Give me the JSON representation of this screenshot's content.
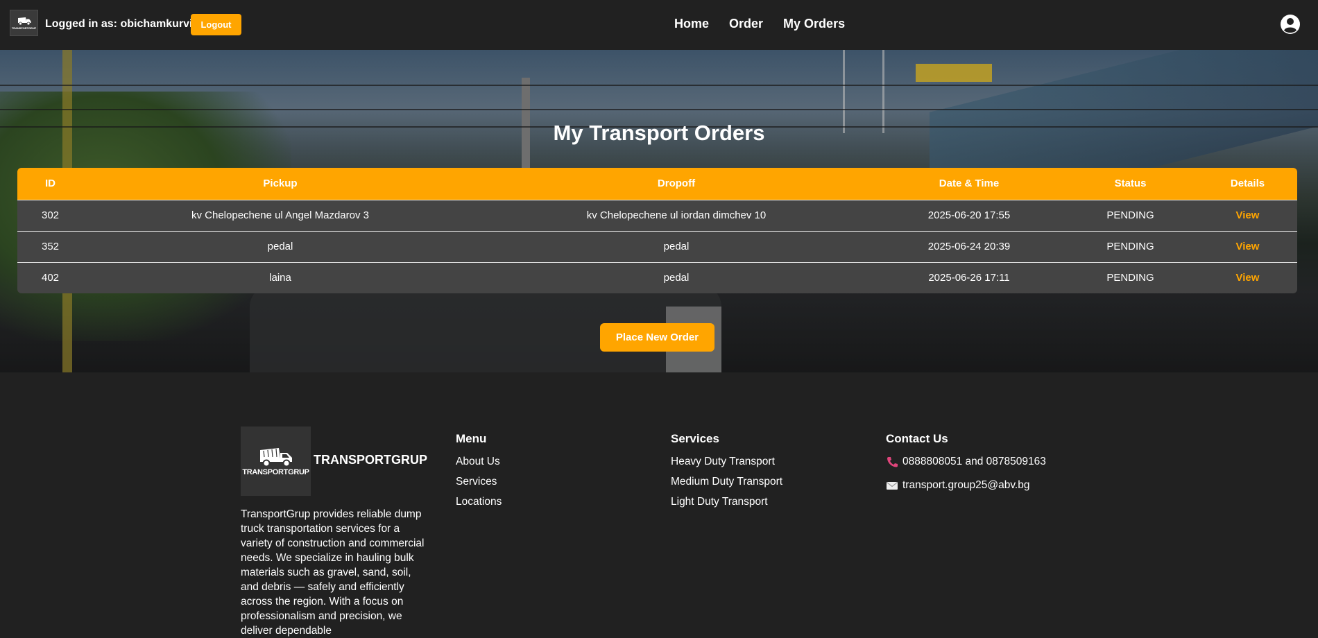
{
  "header": {
    "logo_text": "TRANSPORTGRUP",
    "logged_in_text": "Logged in as: obichamkurvi",
    "logout_label": "Logout",
    "nav": [
      {
        "label": "Home"
      },
      {
        "label": "Order"
      },
      {
        "label": "My Orders"
      }
    ],
    "user_icon": "user-circle-icon"
  },
  "main": {
    "title": "My Transport Orders",
    "columns": [
      "ID",
      "Pickup",
      "Dropoff",
      "Date & Time",
      "Status",
      "Details"
    ],
    "orders": [
      {
        "id": "302",
        "pickup": "kv Chelopechene ul Angel Mazdarov 3",
        "dropoff": "kv Chelopechene ul iordan dimchev 10",
        "datetime": "2025-06-20 17:55",
        "status": "PENDING",
        "details": "View"
      },
      {
        "id": "352",
        "pickup": "pedal",
        "dropoff": "pedal",
        "datetime": "2025-06-24 20:39",
        "status": "PENDING",
        "details": "View"
      },
      {
        "id": "402",
        "pickup": "laina",
        "dropoff": "pedal",
        "datetime": "2025-06-26 17:11",
        "status": "PENDING",
        "details": "View"
      }
    ],
    "new_order_label": "Place New Order"
  },
  "footer": {
    "logo_text": "TRANSPORTGRUP",
    "brand": "TRANSPORTGRUP",
    "description": "TransportGrup provides reliable dump truck transportation services for a variety of construction and commercial needs. We specialize in hauling bulk materials such as gravel, sand, soil, and debris — safely and efficiently across the region. With a focus on professionalism and precision, we deliver dependable",
    "menu": {
      "title": "Menu",
      "items": [
        "About Us",
        "Services",
        "Locations"
      ]
    },
    "services": {
      "title": "Services",
      "items": [
        "Heavy Duty Transport",
        "Medium Duty Transport",
        "Light Duty Transport"
      ]
    },
    "contact": {
      "title": "Contact Us",
      "phone": "0888808051 and 0878509163",
      "email": "transport.group25@abv.bg"
    }
  },
  "colors": {
    "accent": "#ffa500",
    "background": "#212121",
    "row": "#444444"
  }
}
